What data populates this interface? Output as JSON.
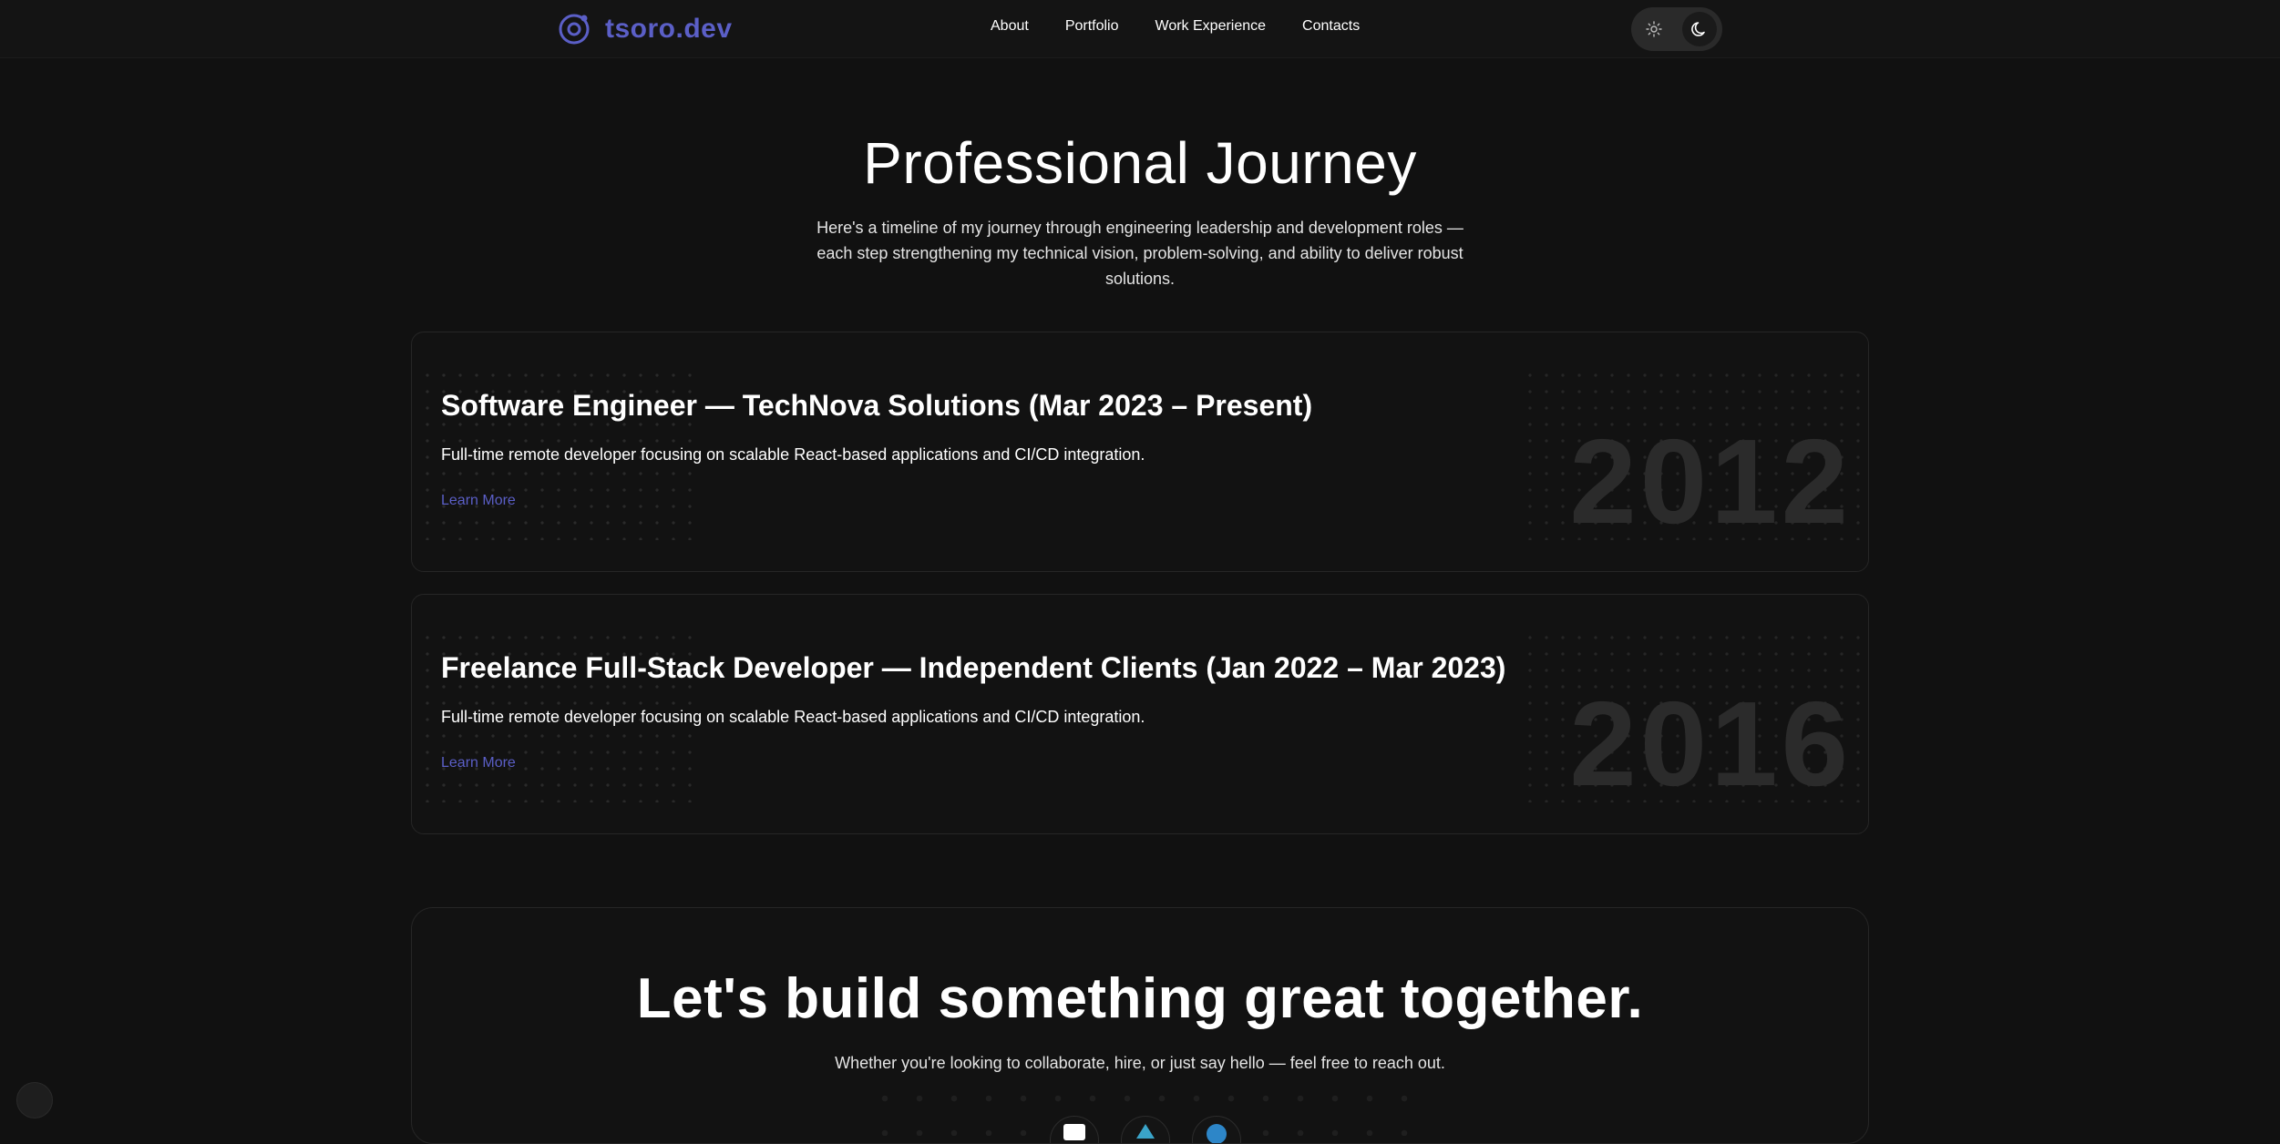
{
  "header": {
    "brand": "tsoro.dev",
    "nav": [
      "About",
      "Portfolio",
      "Work Experience",
      "Contacts"
    ],
    "theme_toggle": {
      "options": [
        "sun-icon",
        "moon-icon"
      ],
      "active": "moon-icon"
    }
  },
  "hero": {
    "title": "Professional Journey",
    "subtitle": "Here's a timeline of my journey through engineering leadership and development roles — each step strengthening my technical vision, problem-solving, and ability to deliver robust solutions."
  },
  "jobs": [
    {
      "title": "Software Engineer — TechNova Solutions (Mar 2023 – Present)",
      "description": "Full-time remote developer focusing on scalable React-based applications and CI/CD integration.",
      "link": "Learn More",
      "year": "2012"
    },
    {
      "title": "Freelance Full-Stack Developer — Independent Clients (Jan 2022 – Mar 2023)",
      "description": "Full-time remote developer focusing on scalable React-based applications and CI/CD integration.",
      "link": "Learn More",
      "year": "2016"
    }
  ],
  "cta": {
    "title": "Let's build something great together.",
    "subtitle": "Whether you're looking to collaborate, hire, or just say hello — feel free to reach out.",
    "socials": [
      "mail-icon",
      "telegram-icon",
      "linkedin-icon"
    ]
  },
  "colors": {
    "background": "#111111",
    "accent": "#5b5fc7",
    "card_border": "#262626",
    "year_text": "#2b2b2b"
  }
}
